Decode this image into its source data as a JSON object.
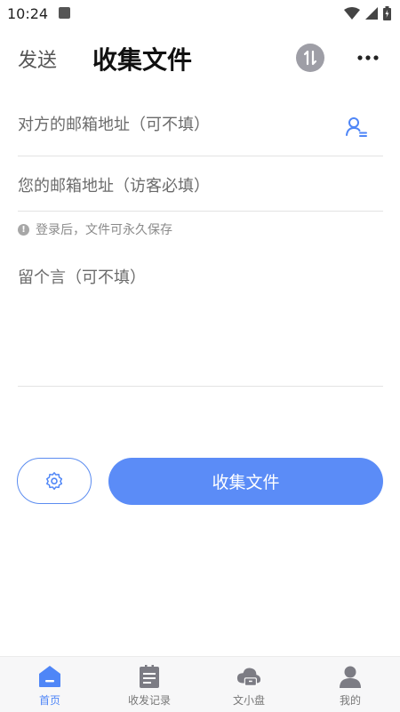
{
  "status_bar": {
    "time": "10:24"
  },
  "header": {
    "send_tab": "发送",
    "collect_title": "收集文件",
    "sort_icon": "sort-updown-icon",
    "more_icon": "more-dots-icon"
  },
  "form": {
    "recipient_email_placeholder": "对方的邮箱地址（可不填）",
    "your_email_placeholder": "您的邮箱地址（访客必填）",
    "login_notice": "登录后，文件可永久保存",
    "message_placeholder": "留个言（可不填）"
  },
  "actions": {
    "collect_button": "收集文件",
    "settings_icon": "gear-icon"
  },
  "bottom_nav": {
    "items": [
      {
        "label": "首页",
        "icon": "home-icon",
        "active": true
      },
      {
        "label": "收发记录",
        "icon": "records-icon",
        "active": false
      },
      {
        "label": "文小盘",
        "icon": "cloud-drive-icon",
        "active": false
      },
      {
        "label": "我的",
        "icon": "profile-icon",
        "active": false
      }
    ]
  },
  "colors": {
    "accent": "#5b8cf7",
    "active_nav": "#4f86f7",
    "divider": "#e3e3e3"
  }
}
